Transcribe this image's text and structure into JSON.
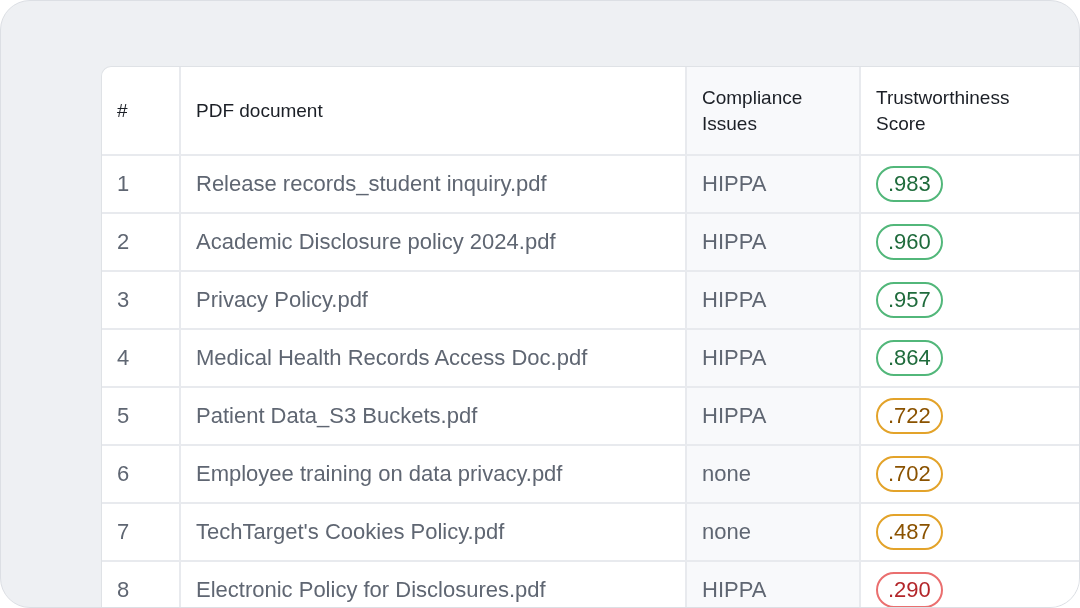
{
  "table": {
    "columns": [
      "#",
      "PDF document",
      "Compliance Issues",
      "Trustworthiness Score"
    ],
    "rows": [
      {
        "index": "1",
        "document": "Release records_student inquiry.pdf",
        "compliance": "HIPPA",
        "score": ".983",
        "kind": "high"
      },
      {
        "index": "2",
        "document": "Academic Disclosure policy 2024.pdf",
        "compliance": "HIPPA",
        "score": ".960",
        "kind": "high"
      },
      {
        "index": "3",
        "document": "Privacy Policy.pdf",
        "compliance": "HIPPA",
        "score": ".957",
        "kind": "high"
      },
      {
        "index": "4",
        "document": "Medical Health Records Access Doc.pdf",
        "compliance": "HIPPA",
        "score": ".864",
        "kind": "high"
      },
      {
        "index": "5",
        "document": "Patient Data_S3 Buckets.pdf",
        "compliance": "HIPPA",
        "score": ".722",
        "kind": "medium"
      },
      {
        "index": "6",
        "document": "Employee training on data privacy.pdf",
        "compliance": "none",
        "score": ".702",
        "kind": "medium"
      },
      {
        "index": "7",
        "document": "TechTarget's Cookies Policy.pdf",
        "compliance": "none",
        "score": ".487",
        "kind": "medium"
      },
      {
        "index": "8",
        "document": "Electronic Policy for Disclosures.pdf",
        "compliance": "HIPPA",
        "score": ".290",
        "kind": "low"
      }
    ]
  }
}
